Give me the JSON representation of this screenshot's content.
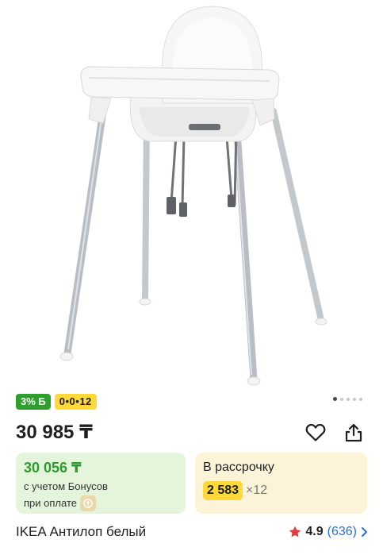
{
  "product": {
    "image_alt": "IKEA Антилоп белый",
    "badges": {
      "bonus": "3% Б",
      "installment": "0•0•12"
    },
    "gallery": {
      "total": 5,
      "active": 1
    },
    "price": "30 985 ₸",
    "title": "IKEA Антилоп белый"
  },
  "bonus_card": {
    "price": "30 056 ₸",
    "note_line1": "с учетом Бонусов",
    "note_line2": "при оплате"
  },
  "credit_card": {
    "title": "В рассрочку",
    "amount": "2 583",
    "months": "×12"
  },
  "rating": {
    "value": "4.9",
    "count": "(636)"
  },
  "colors": {
    "bonus_green": "#2e9a2e",
    "installment_yellow": "#ffd83a",
    "link_blue": "#2d6fd6",
    "star_red": "#e23b3b"
  },
  "icons": [
    "heart-icon",
    "share-icon",
    "star-icon",
    "chevron-right-icon",
    "wallet-icon"
  ]
}
